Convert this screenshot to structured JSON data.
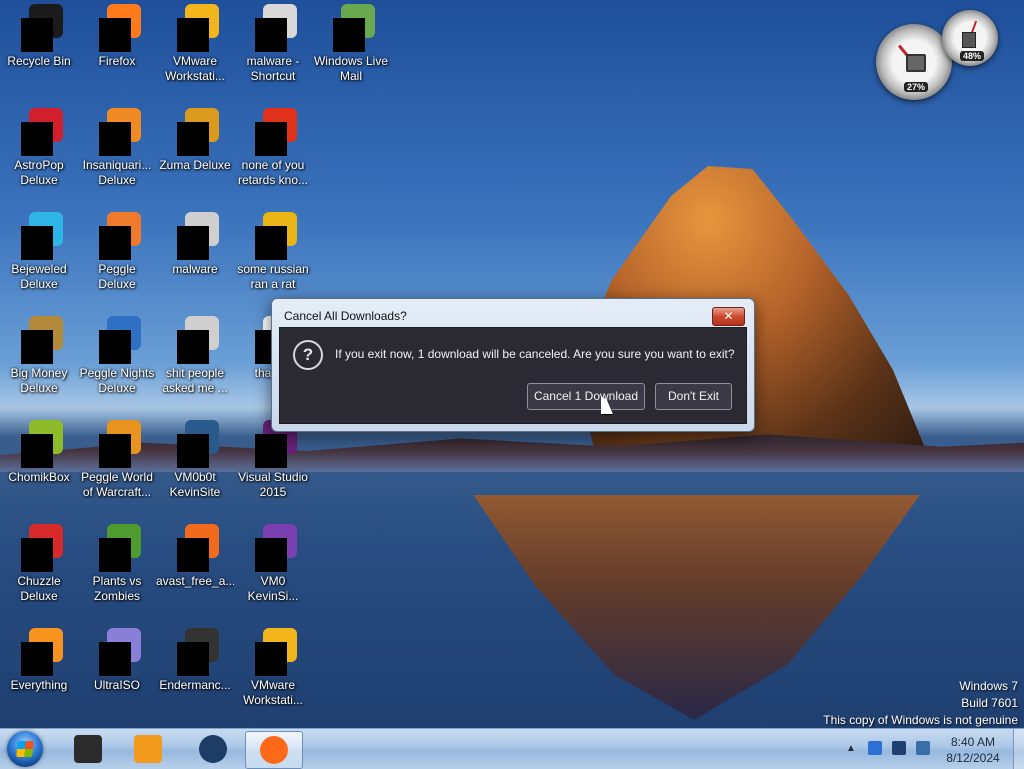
{
  "desktop": {
    "icons": [
      {
        "label": "Recycle Bin",
        "icon": "recycle-bin-icon",
        "color": "#1b1b1b"
      },
      {
        "label": "Firefox",
        "icon": "firefox-icon",
        "color": "#ff7a1a"
      },
      {
        "label": "VMware Workstati...",
        "icon": "vmware-icon",
        "color": "#f2b51b"
      },
      {
        "label": "malware - Shortcut",
        "icon": "folder-shortcut-icon",
        "color": "#d8d8d8"
      },
      {
        "label": "Windows Live Mail",
        "icon": "windows-live-mail-icon",
        "color": "#6aa84f"
      },
      {
        "label": "AstroPop Deluxe",
        "icon": "astropop-icon",
        "color": "#d11f2e"
      },
      {
        "label": "Insaniquari... Deluxe",
        "icon": "insaniquarium-icon",
        "color": "#f08a24"
      },
      {
        "label": "Zuma Deluxe",
        "icon": "zuma-icon",
        "color": "#d99a1e"
      },
      {
        "label": "none of you retards kno...",
        "icon": "firefox-dev-icon",
        "color": "#e0321b"
      },
      {
        "label": "Bejeweled Deluxe",
        "icon": "bejeweled-icon",
        "color": "#2fb4e8"
      },
      {
        "label": "Peggle Deluxe",
        "icon": "peggle-icon",
        "color": "#f07a2c"
      },
      {
        "label": "malware",
        "icon": "folder-icon",
        "color": "#cfcfcf"
      },
      {
        "label": "some russian ran a rat",
        "icon": "document-icon",
        "color": "#e8b416"
      },
      {
        "label": "Big Money Deluxe",
        "icon": "big-money-icon",
        "color": "#b38a3a"
      },
      {
        "label": "Peggle Nights Deluxe",
        "icon": "peggle-nights-icon",
        "color": "#2f6fc4"
      },
      {
        "label": "shit people asked me ...",
        "icon": "folder-icon",
        "color": "#cfcfcf"
      },
      {
        "label": "that bu",
        "icon": "generic-app-icon",
        "color": "#ffffff"
      },
      {
        "label": "ChomikBox",
        "icon": "chomikbox-icon",
        "color": "#8dbb2a"
      },
      {
        "label": "Peggle World of Warcraft...",
        "icon": "peggle-wow-icon",
        "color": "#e8931e"
      },
      {
        "label": "VM0b0t KevinSite",
        "icon": "vm-shortcut-icon",
        "color": "#2a5a8c"
      },
      {
        "label": "Visual Studio 2015",
        "icon": "visual-studio-icon",
        "color": "#68217a"
      },
      {
        "label": "Chuzzle Deluxe",
        "icon": "chuzzle-icon",
        "color": "#d82a2a"
      },
      {
        "label": "Plants vs Zombies",
        "icon": "plants-vs-zombies-icon",
        "color": "#4e9b2f"
      },
      {
        "label": "avast_free_a...",
        "icon": "avast-icon",
        "color": "#f26b1d"
      },
      {
        "label": "VM0 KevinSi...",
        "icon": "vm-shortcut-icon",
        "color": "#7a3fb0"
      },
      {
        "label": "Everything",
        "icon": "everything-search-icon",
        "color": "#f7931e"
      },
      {
        "label": "UltraISO",
        "icon": "ultraiso-icon",
        "color": "#8a7fd8"
      },
      {
        "label": "Endermanc...",
        "icon": "terminal-icon",
        "color": "#333333"
      },
      {
        "label": "VMware Workstati...",
        "icon": "vmware-icon",
        "color": "#f2b51b"
      }
    ]
  },
  "gadget": {
    "cpu_value": "27%",
    "memory_value": "48%"
  },
  "dialog": {
    "title": "Cancel All Downloads?",
    "close_label": "✕",
    "icon": "question-icon",
    "message": "If you exit now, 1 download will be canceled. Are you sure you want to exit?",
    "primary_button": "Cancel 1 Download",
    "secondary_button": "Don't Exit"
  },
  "watermark": {
    "line1": "Windows 7",
    "line2": "Build 7601",
    "line3": "This copy of Windows is not genuine"
  },
  "taskbar": {
    "start_icon": "windows-start-icon",
    "items": [
      {
        "icon": "console-app-icon",
        "color": "#2b2b2b",
        "active": false
      },
      {
        "icon": "media-player-icon",
        "color": "#f29a1b",
        "active": false
      },
      {
        "icon": "globe-icon",
        "color": "#1d3d66",
        "active": false
      },
      {
        "icon": "firefox-icon",
        "color": "#ff6a1a",
        "active": true
      }
    ],
    "tray": {
      "show_hidden_label": "▲",
      "icons": [
        {
          "icon": "network-icon",
          "color": "#2d6fd2"
        },
        {
          "icon": "monitor-icon",
          "color": "#1f3f70"
        },
        {
          "icon": "volume-icon",
          "color": "#3a6ea8"
        }
      ],
      "time": "8:40 AM",
      "date": "8/12/2024"
    }
  }
}
